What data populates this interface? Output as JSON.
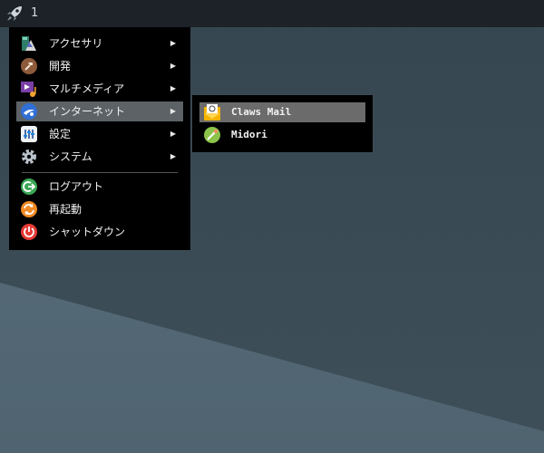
{
  "panel": {
    "workspace": "1",
    "launcher_icon": "rocket-icon"
  },
  "menu": {
    "items": [
      {
        "label": "アクセサリ",
        "icon": "accessories-icon",
        "has_submenu": true
      },
      {
        "label": "開発",
        "icon": "development-icon",
        "has_submenu": true
      },
      {
        "label": "マルチメディア",
        "icon": "multimedia-icon",
        "has_submenu": true
      },
      {
        "label": "インターネット",
        "icon": "internet-icon",
        "has_submenu": true,
        "active": true
      },
      {
        "label": "設定",
        "icon": "settings-icon",
        "has_submenu": true
      },
      {
        "label": "システム",
        "icon": "system-icon",
        "has_submenu": true
      },
      {
        "label": "ログアウト",
        "icon": "logout-icon",
        "has_submenu": false
      },
      {
        "label": "再起動",
        "icon": "reboot-icon",
        "has_submenu": false
      },
      {
        "label": "シャットダウン",
        "icon": "shutdown-icon",
        "has_submenu": false
      }
    ],
    "arrow": "▶"
  },
  "submenu": {
    "items": [
      {
        "label": "Claws Mail",
        "icon": "mail-icon",
        "active": true
      },
      {
        "label": "Midori",
        "icon": "browser-icon"
      }
    ]
  },
  "colors": {
    "panel": "#1c2227",
    "menu_bg": "#000000",
    "highlight": "#5c6266"
  }
}
